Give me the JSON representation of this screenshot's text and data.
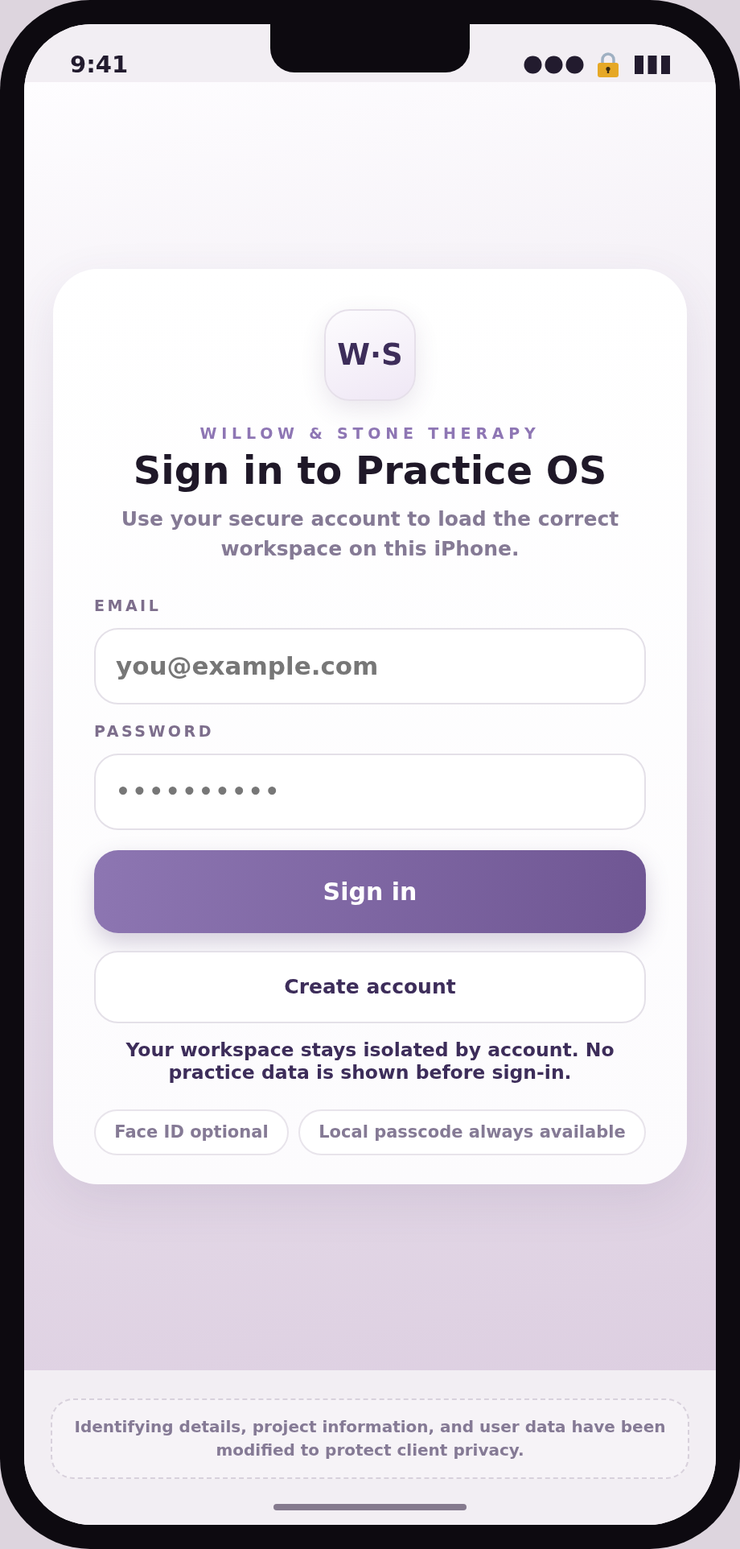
{
  "status_bar": {
    "time": "9:41"
  },
  "card": {
    "logo": "W·S",
    "brand": "WILLOW & STONE THERAPY",
    "title": "Sign in to Practice OS",
    "subtitle": "Use your secure account to load the correct workspace on this iPhone."
  },
  "fields": [
    {
      "label": "EMAIL",
      "placeholder": "you@example.com"
    },
    {
      "label": "PASSWORD",
      "value": "••••••••••"
    }
  ],
  "buttons": [
    {
      "label": "Sign in",
      "kind": "primary"
    },
    {
      "label": "Create account",
      "kind": "secondary"
    }
  ],
  "note": "Your workspace stays isolated by account. No practice data is shown before sign-in.",
  "chips": [
    "Face ID optional",
    "Local passcode always available"
  ],
  "disclaimer": "Identifying details, project information, and user data have been modified to protect client privacy."
}
